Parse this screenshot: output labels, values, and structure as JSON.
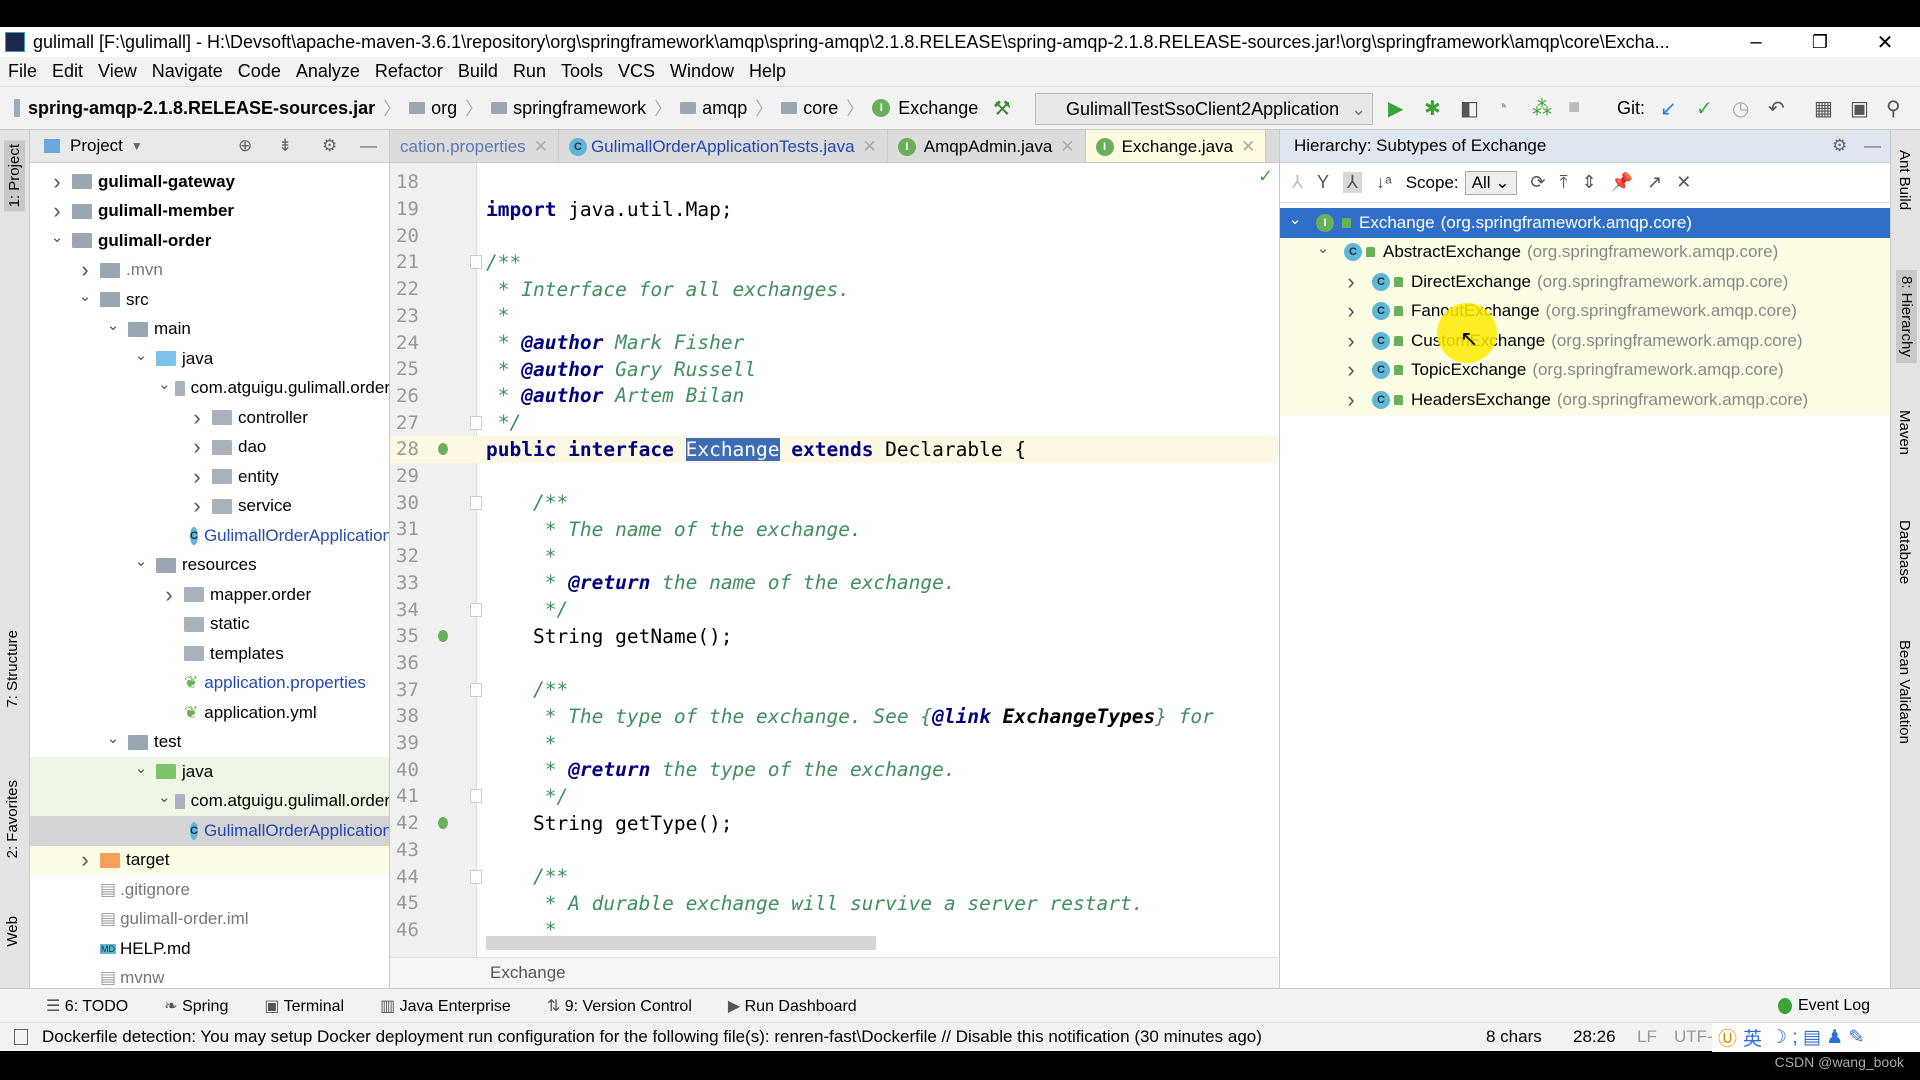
{
  "window": {
    "title": "gulimall [F:\\gulimall] - H:\\Devsoft\\apache-maven-3.6.1\\repository\\org\\springframework\\amqp\\spring-amqp\\2.1.8.RELEASE\\spring-amqp-2.1.8.RELEASE-sources.jar!\\org\\springframework\\amqp\\core\\Excha...",
    "logo": "IJ",
    "minimize": "–",
    "restore": "❐",
    "close": "✕"
  },
  "menu": [
    "File",
    "Edit",
    "View",
    "Navigate",
    "Code",
    "Analyze",
    "Refactor",
    "Build",
    "Run",
    "Tools",
    "VCS",
    "Window",
    "Help"
  ],
  "breadcrumb": [
    "spring-amqp-2.1.8.RELEASE-sources.jar",
    "org",
    "springframework",
    "amqp",
    "core",
    "Exchange"
  ],
  "toolbar": {
    "run_config": "GulimallTestSsoClient2Application",
    "git_label": "Git:"
  },
  "left_strip": [
    "1: Project",
    "7: Structure",
    "2: Favorites",
    "Web"
  ],
  "right_strip": [
    "Ant Build",
    "8: Hierarchy",
    "Maven",
    "Database",
    "Bean Validation"
  ],
  "project": {
    "title": "Project",
    "tree": [
      {
        "label": "gulimall-gateway",
        "depth": 0,
        "arrow": "collapsed",
        "icon": "module",
        "bold": true
      },
      {
        "label": "gulimall-member",
        "depth": 0,
        "arrow": "collapsed",
        "icon": "module",
        "bold": true
      },
      {
        "label": "gulimall-order",
        "depth": 0,
        "arrow": "expanded",
        "icon": "module",
        "bold": true
      },
      {
        "label": ".mvn",
        "depth": 1,
        "arrow": "collapsed",
        "icon": "folder",
        "muted": true
      },
      {
        "label": "src",
        "depth": 1,
        "arrow": "expanded",
        "icon": "folder"
      },
      {
        "label": "main",
        "depth": 2,
        "arrow": "expanded",
        "icon": "folder"
      },
      {
        "label": "java",
        "depth": 3,
        "arrow": "expanded",
        "icon": "source-folder"
      },
      {
        "label": "com.atguigu.gulimall.order",
        "depth": 4,
        "arrow": "expanded",
        "icon": "package"
      },
      {
        "label": "controller",
        "depth": 5,
        "arrow": "collapsed",
        "icon": "package"
      },
      {
        "label": "dao",
        "depth": 5,
        "arrow": "collapsed",
        "icon": "package"
      },
      {
        "label": "entity",
        "depth": 5,
        "arrow": "collapsed",
        "icon": "package"
      },
      {
        "label": "service",
        "depth": 5,
        "arrow": "collapsed",
        "icon": "package"
      },
      {
        "label": "GulimallOrderApplication",
        "depth": 5,
        "arrow": "none",
        "icon": "spring-class",
        "link": true
      },
      {
        "label": "resources",
        "depth": 3,
        "arrow": "expanded",
        "icon": "resources-folder"
      },
      {
        "label": "mapper.order",
        "depth": 4,
        "arrow": "collapsed",
        "icon": "package"
      },
      {
        "label": "static",
        "depth": 4,
        "arrow": "none",
        "icon": "package"
      },
      {
        "label": "templates",
        "depth": 4,
        "arrow": "none",
        "icon": "package"
      },
      {
        "label": "application.properties",
        "depth": 4,
        "arrow": "none",
        "icon": "spring-config",
        "link": true
      },
      {
        "label": "application.yml",
        "depth": 4,
        "arrow": "none",
        "icon": "spring-config"
      },
      {
        "label": "test",
        "depth": 2,
        "arrow": "expanded",
        "icon": "folder"
      },
      {
        "label": "java",
        "depth": 3,
        "arrow": "expanded",
        "icon": "test-folder",
        "bg": "green"
      },
      {
        "label": "com.atguigu.gulimall.order",
        "depth": 4,
        "arrow": "expanded",
        "icon": "package",
        "bg": "green"
      },
      {
        "label": "GulimallOrderApplicationTests",
        "depth": 5,
        "arrow": "none",
        "icon": "class",
        "link": true,
        "bg": "selected"
      },
      {
        "label": "target",
        "depth": 1,
        "arrow": "collapsed",
        "icon": "excluded-folder",
        "bg": "yellow"
      },
      {
        "label": ".gitignore",
        "depth": 1,
        "arrow": "none",
        "icon": "file",
        "muted": true
      },
      {
        "label": "gulimall-order.iml",
        "depth": 1,
        "arrow": "none",
        "icon": "file",
        "muted": true
      },
      {
        "label": "HELP.md",
        "depth": 1,
        "arrow": "none",
        "icon": "md-file"
      },
      {
        "label": "mvnw",
        "depth": 1,
        "arrow": "none",
        "icon": "file",
        "muted": true
      }
    ]
  },
  "editor": {
    "tabs": [
      {
        "label": "cation.properties",
        "icon": "none",
        "active": false
      },
      {
        "label": "GulimallOrderApplicationTests.java",
        "icon": "class",
        "active": false
      },
      {
        "label": "AmqpAdmin.java",
        "icon": "interface",
        "active": false
      },
      {
        "label": "Exchange.java",
        "icon": "interface",
        "active": true
      }
    ],
    "footer_crumb": "Exchange",
    "lines": [
      {
        "n": "18",
        "t": []
      },
      {
        "n": "19",
        "t": [
          [
            "kw",
            "import"
          ],
          [
            "p",
            " java.util.Map;"
          ]
        ]
      },
      {
        "n": "20",
        "t": []
      },
      {
        "n": "21",
        "t": [
          [
            "cm",
            "/**"
          ]
        ],
        "fold": true
      },
      {
        "n": "22",
        "t": [
          [
            "cm",
            " * Interface for all exchanges."
          ]
        ]
      },
      {
        "n": "23",
        "t": [
          [
            "cm",
            " *"
          ]
        ]
      },
      {
        "n": "24",
        "t": [
          [
            "cm",
            " * "
          ],
          [
            "tag",
            "@author"
          ],
          [
            "cm",
            " Mark Fisher"
          ]
        ]
      },
      {
        "n": "25",
        "t": [
          [
            "cm",
            " * "
          ],
          [
            "tag",
            "@author"
          ],
          [
            "cm",
            " Gary Russell"
          ]
        ]
      },
      {
        "n": "26",
        "t": [
          [
            "cm",
            " * "
          ],
          [
            "tag",
            "@author"
          ],
          [
            "cm",
            " Artem Bilan"
          ]
        ]
      },
      {
        "n": "27",
        "t": [
          [
            "cm",
            " */"
          ]
        ],
        "fold": true
      },
      {
        "n": "28",
        "t": [
          [
            "kw",
            "public interface "
          ],
          [
            "sel",
            "Exchange"
          ],
          [
            "kw",
            " extends"
          ],
          [
            "p",
            " Declarable {"
          ]
        ],
        "current": true,
        "impl": true
      },
      {
        "n": "29",
        "t": []
      },
      {
        "n": "30",
        "t": [
          [
            "cm",
            "    /**"
          ]
        ],
        "fold": true
      },
      {
        "n": "31",
        "t": [
          [
            "cm",
            "     * The name of the exchange."
          ]
        ]
      },
      {
        "n": "32",
        "t": [
          [
            "cm",
            "     *"
          ]
        ]
      },
      {
        "n": "33",
        "t": [
          [
            "cm",
            "     * "
          ],
          [
            "tag",
            "@return"
          ],
          [
            "cm",
            " the name of the exchange."
          ]
        ]
      },
      {
        "n": "34",
        "t": [
          [
            "cm",
            "     */"
          ]
        ],
        "fold": true
      },
      {
        "n": "35",
        "t": [
          [
            "p",
            "    String getName();"
          ]
        ],
        "impl": true
      },
      {
        "n": "36",
        "t": []
      },
      {
        "n": "37",
        "t": [
          [
            "cm",
            "    /**"
          ]
        ],
        "fold": true
      },
      {
        "n": "38",
        "t": [
          [
            "cm",
            "     * The type of the exchange. See {"
          ],
          [
            "tag",
            "@link"
          ],
          [
            "ref",
            " ExchangeTypes"
          ],
          [
            "cm",
            "} for"
          ]
        ]
      },
      {
        "n": "39",
        "t": [
          [
            "cm",
            "     *"
          ]
        ]
      },
      {
        "n": "40",
        "t": [
          [
            "cm",
            "     * "
          ],
          [
            "tag",
            "@return"
          ],
          [
            "cm",
            " the type of the exchange."
          ]
        ]
      },
      {
        "n": "41",
        "t": [
          [
            "cm",
            "     */"
          ]
        ],
        "fold": true
      },
      {
        "n": "42",
        "t": [
          [
            "p",
            "    String getType();"
          ]
        ],
        "impl": true
      },
      {
        "n": "43",
        "t": []
      },
      {
        "n": "44",
        "t": [
          [
            "cm",
            "    /**"
          ]
        ],
        "fold": true
      },
      {
        "n": "45",
        "t": [
          [
            "cm",
            "     * A durable exchange will survive a server restart."
          ]
        ]
      },
      {
        "n": "46",
        "t": [
          [
            "cm",
            "     *"
          ]
        ]
      }
    ]
  },
  "hierarchy": {
    "title": "Hierarchy:  Subtypes of Exchange",
    "scope_label": "Scope:",
    "scope_value": "All",
    "items": [
      {
        "name": "Exchange",
        "pkg": "(org.springframework.amqp.core)",
        "depth": 0,
        "arrow": "expanded",
        "icon": "interface",
        "selected": true
      },
      {
        "name": "AbstractExchange",
        "pkg": "(org.springframework.amqp.core)",
        "depth": 1,
        "arrow": "expanded",
        "icon": "abstract-class"
      },
      {
        "name": "DirectExchange",
        "pkg": "(org.springframework.amqp.core)",
        "depth": 2,
        "arrow": "collapsed",
        "icon": "class"
      },
      {
        "name": "FanoutExchange",
        "pkg": "(org.springframework.amqp.core)",
        "depth": 2,
        "arrow": "collapsed",
        "icon": "class"
      },
      {
        "name": "CustomExchange",
        "pkg": "(org.springframework.amqp.core)",
        "depth": 2,
        "arrow": "collapsed",
        "icon": "class"
      },
      {
        "name": "TopicExchange",
        "pkg": "(org.springframework.amqp.core)",
        "depth": 2,
        "arrow": "collapsed",
        "icon": "class"
      },
      {
        "name": "HeadersExchange",
        "pkg": "(org.springframework.amqp.core)",
        "depth": 2,
        "arrow": "collapsed",
        "icon": "class"
      }
    ]
  },
  "bottom_tabs": [
    "6: TODO",
    "Spring",
    "Terminal",
    "Java Enterprise",
    "9: Version Control",
    "Run Dashboard"
  ],
  "event_log": "Event Log",
  "status": {
    "message": "Dockerfile detection: You may setup Docker deployment run configuration for the following file(s): renren-fast\\Dockerfile // Disable this notification (30 minutes ago)",
    "chars": "8 chars",
    "position": "28:26",
    "line_sep": "LF",
    "encoding": "UTF-",
    "ime": "英"
  },
  "watermark": "CSDN @wang_book",
  "colors": {
    "selection": "#3e6db5",
    "keyword": "#000080",
    "comment": "#3f8f5f",
    "hierarchy_bg": "#fdfde6"
  }
}
